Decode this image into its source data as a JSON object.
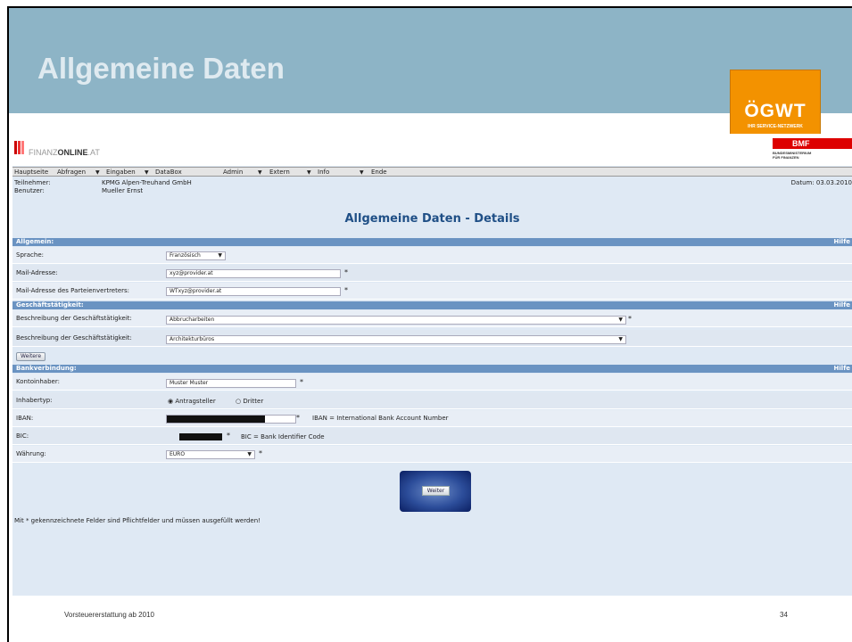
{
  "slide": {
    "title": "Allgemeine Daten",
    "footer_left": "Vorsteuererstattung ab 2010",
    "footer_right": "34"
  },
  "ogwt": {
    "logo_text": "ÖGWT",
    "subtitle": "IHR SERVICE-NETZWERK"
  },
  "bmf": {
    "logo_text": "BMF",
    "subtitle_1": "BUNDESMINISTERIUM",
    "subtitle_2": "FÜR FINANZEN"
  },
  "app": {
    "brand_light": "FINANZ",
    "brand_bold": "ONLINE",
    "brand_suffix": ".AT",
    "menu": [
      {
        "label": "Hauptseite",
        "arrow": false
      },
      {
        "label": "Abfragen",
        "arrow": true
      },
      {
        "label": "Eingaben",
        "arrow": true
      },
      {
        "label": "DataBox",
        "arrow": false
      },
      {
        "label": "Admin",
        "arrow": true
      },
      {
        "label": "Extern",
        "arrow": true
      },
      {
        "label": "Info",
        "arrow": true
      },
      {
        "label": "Ende",
        "arrow": false
      }
    ],
    "participant_label": "Teilnehmer:",
    "participant_value": "KPMG Alpen-Treuhand GmbH",
    "user_label": "Benutzer:",
    "user_value": "Mueller Ernst",
    "date_text": "Datum: 03.03.2010",
    "page_title": "Allgemeine Daten - Details",
    "help_label": "Hilfe",
    "sections": {
      "allgemein": {
        "label": "Allgemein:",
        "language_label": "Sprache:",
        "language_value": "Französisch",
        "mail_label": "Mail-Adresse:",
        "mail_value": "xyz@provider.at",
        "party_mail_label": "Mail-Adresse des Parteienvertreters:",
        "party_mail_value": "WTxyz@provider.at"
      },
      "geschaeft": {
        "label": "Geschäftstätigkeit:",
        "desc1_label": "Beschreibung der Geschäftstätigkeit:",
        "desc1_value": "Abbrucharbeiten",
        "desc2_label": "Beschreibung der Geschäftstätigkeit:",
        "desc2_value": "Architekturbüros",
        "more_button": "Weitere"
      },
      "bank": {
        "label": "Bankverbindung:",
        "holder_label": "Kontoinhaber:",
        "holder_value": "Muster Muster",
        "type_label": "Inhabertyp:",
        "type_option1": "Antragsteller",
        "type_option2": "Dritter",
        "iban_label": "IBAN:",
        "iban_hint": "IBAN = International Bank Account Number",
        "bic_label": "BIC:",
        "bic_hint": "BIC = Bank Identifier Code",
        "currency_label": "Währung:",
        "currency_value": "EURO"
      }
    },
    "required_mark": "*",
    "submit_button": "Weiter",
    "footnote": "Mit * gekennzeichnete Felder sind Pflichtfelder und müssen ausgefüllt werden!",
    "colors": {
      "section_header": "#6a93c2",
      "title_blue": "#1f4f86",
      "title_band": "#8db4c6",
      "ogwt_orange": "#f39200",
      "bmf_red": "#dd0000"
    }
  }
}
